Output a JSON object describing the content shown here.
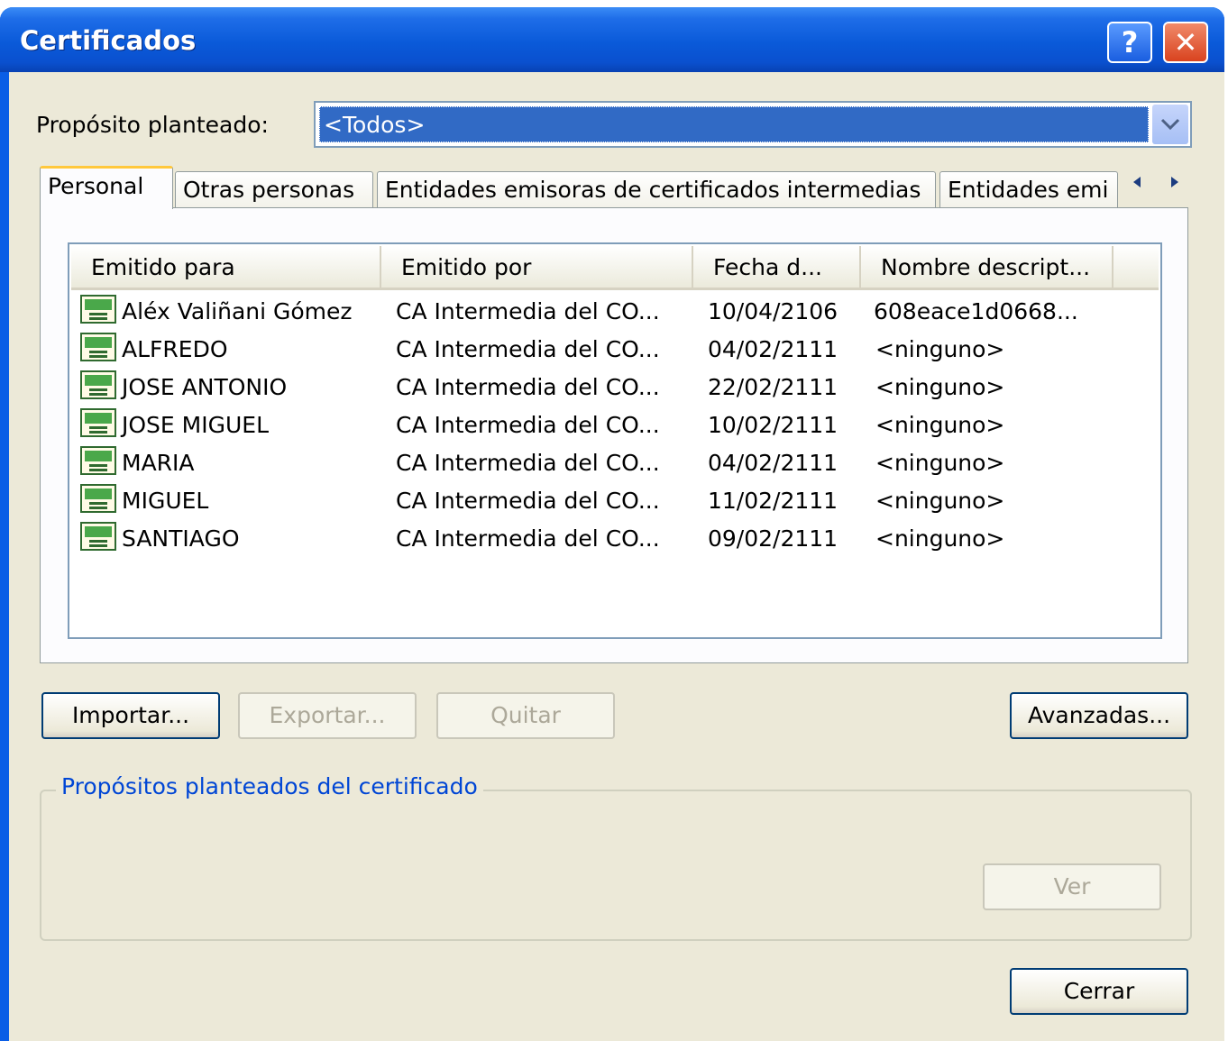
{
  "window": {
    "title": "Certificados",
    "help_label": "?",
    "close_label": "✕"
  },
  "purpose": {
    "label": "Propósito planteado:",
    "value": "<Todos>"
  },
  "tabs": [
    {
      "label": "Personal"
    },
    {
      "label": "Otras personas"
    },
    {
      "label": "Entidades emisoras de certificados intermedias"
    },
    {
      "label": "Entidades emi"
    }
  ],
  "list": {
    "columns": [
      "Emitido para",
      "Emitido por",
      "Fecha d...",
      "Nombre descript..."
    ],
    "rows": [
      {
        "to": "Aléx Valiñani Gómez",
        "by": "CA Intermedia del CO...",
        "date": "10/04/2106",
        "name": "608eace1d0668..."
      },
      {
        "to": "ALFREDO",
        "by": "CA Intermedia del CO...",
        "date": "04/02/2111",
        "name": "<ninguno>"
      },
      {
        "to": "JOSE ANTONIO",
        "by": "CA Intermedia del CO...",
        "date": "22/02/2111",
        "name": "<ninguno>"
      },
      {
        "to": "JOSE MIGUEL",
        "by": "CA Intermedia del CO...",
        "date": "10/02/2111",
        "name": "<ninguno>"
      },
      {
        "to": "MARIA",
        "by": "CA Intermedia del CO...",
        "date": "04/02/2111",
        "name": "<ninguno>"
      },
      {
        "to": "MIGUEL",
        "by": "CA Intermedia del CO...",
        "date": "11/02/2111",
        "name": "<ninguno>"
      },
      {
        "to": "SANTIAGO",
        "by": "CA Intermedia del CO...",
        "date": "09/02/2111",
        "name": "<ninguno>"
      }
    ]
  },
  "buttons": {
    "importar": "Importar...",
    "exportar": "Exportar...",
    "quitar": "Quitar",
    "avanzadas": "Avanzadas...",
    "ver": "Ver",
    "cerrar": "Cerrar"
  },
  "group": {
    "title": "Propósitos planteados del certificado"
  },
  "colors": {
    "titlebar": "#0a5ad9",
    "dialog_bg": "#ece9d8",
    "selection": "#316ac5",
    "group_title": "#0046d5"
  }
}
